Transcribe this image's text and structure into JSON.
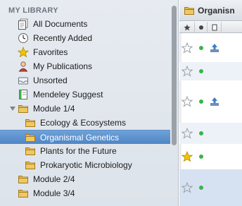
{
  "sidebar": {
    "header": "MY LIBRARY",
    "items": [
      {
        "label": "All Documents",
        "icon": "documents-icon"
      },
      {
        "label": "Recently Added",
        "icon": "clock-icon"
      },
      {
        "label": "Favorites",
        "icon": "star-icon"
      },
      {
        "label": "My Publications",
        "icon": "person-icon"
      },
      {
        "label": "Unsorted",
        "icon": "inbox-icon"
      },
      {
        "label": "Mendeley Suggest",
        "icon": "suggest-icon"
      },
      {
        "label": "Module 1/4",
        "icon": "folder-icon",
        "expanded": true
      },
      {
        "label": "Ecology & Ecosystems",
        "icon": "folder-icon"
      },
      {
        "label": "Organismal Genetics",
        "icon": "folder-icon",
        "selected": true
      },
      {
        "label": "Plants for the Future",
        "icon": "folder-icon"
      },
      {
        "label": "Prokaryotic Microbiology",
        "icon": "folder-icon"
      },
      {
        "label": "Module 2/4",
        "icon": "folder-icon"
      },
      {
        "label": "Module 3/4",
        "icon": "folder-icon"
      }
    ]
  },
  "content": {
    "title": "Organisn",
    "rows": [
      {
        "favorite": false,
        "read": true,
        "uploaded": true
      },
      {
        "favorite": false,
        "read": true,
        "uploaded": false
      },
      {
        "favorite": false,
        "read": true,
        "uploaded": true
      },
      {
        "favorite": false,
        "read": true,
        "uploaded": false
      },
      {
        "favorite": true,
        "read": true,
        "uploaded": false
      },
      {
        "favorite": false,
        "read": true,
        "uploaded": false
      }
    ]
  },
  "colors": {
    "selection": "#4f86c6",
    "folder": "#e7b84a",
    "read_dot": "#3bb34a",
    "favorite_star": "#f2c400"
  }
}
